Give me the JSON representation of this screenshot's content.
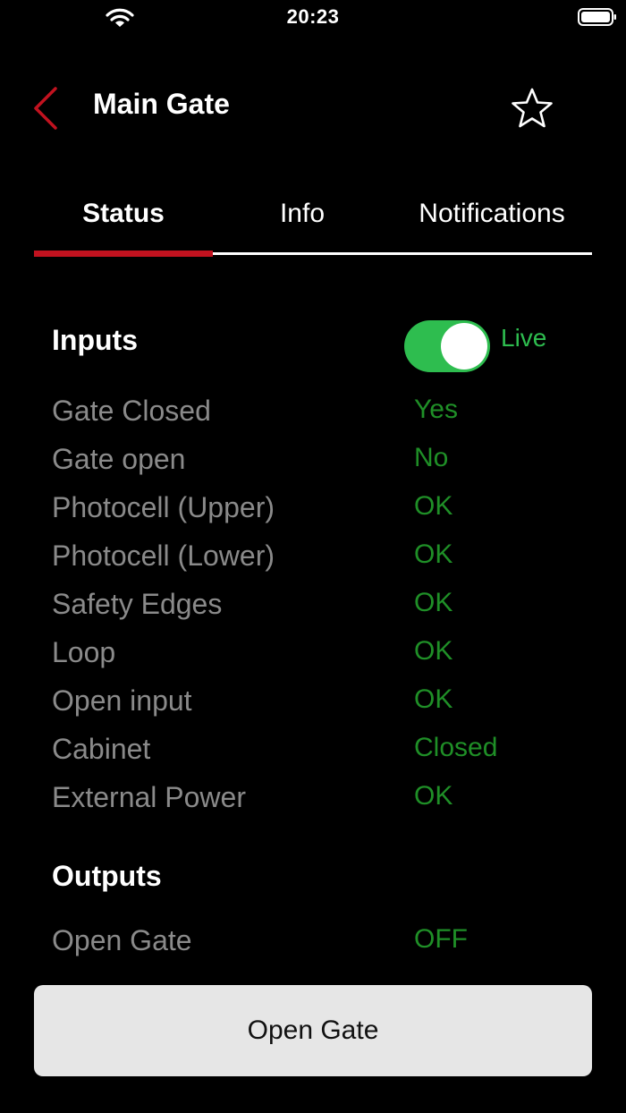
{
  "status_bar": {
    "time": "20:23",
    "wifi_icon": "wifi-icon",
    "battery_icon": "battery-icon"
  },
  "header": {
    "title": "Main Gate",
    "back_icon": "chevron-left-icon",
    "favorite_icon": "star-outline-icon"
  },
  "tabs": [
    {
      "label": "Status",
      "active": true
    },
    {
      "label": "Info",
      "active": false
    },
    {
      "label": "Notifications",
      "active": false
    }
  ],
  "inputs": {
    "heading": "Inputs",
    "live_label": "Live",
    "live_enabled": true,
    "rows": [
      {
        "label": "Gate Closed",
        "value": "Yes"
      },
      {
        "label": "Gate open",
        "value": "No"
      },
      {
        "label": "Photocell (Upper)",
        "value": "OK"
      },
      {
        "label": "Photocell (Lower)",
        "value": "OK"
      },
      {
        "label": "Safety Edges",
        "value": "OK"
      },
      {
        "label": "Loop",
        "value": "OK"
      },
      {
        "label": "Open input",
        "value": "OK"
      },
      {
        "label": "Cabinet",
        "value": "Closed"
      },
      {
        "label": "External Power",
        "value": "OK"
      }
    ]
  },
  "outputs": {
    "heading": "Outputs",
    "rows": [
      {
        "label": "Open Gate",
        "value": "OFF"
      }
    ]
  },
  "action_button": {
    "label": "Open Gate"
  },
  "colors": {
    "accent_red": "#c1121f",
    "live_green": "#2ebd4f",
    "value_green": "#1f8f27",
    "label_gray": "#8a8a8a",
    "button_bg": "#e6e6e6"
  }
}
